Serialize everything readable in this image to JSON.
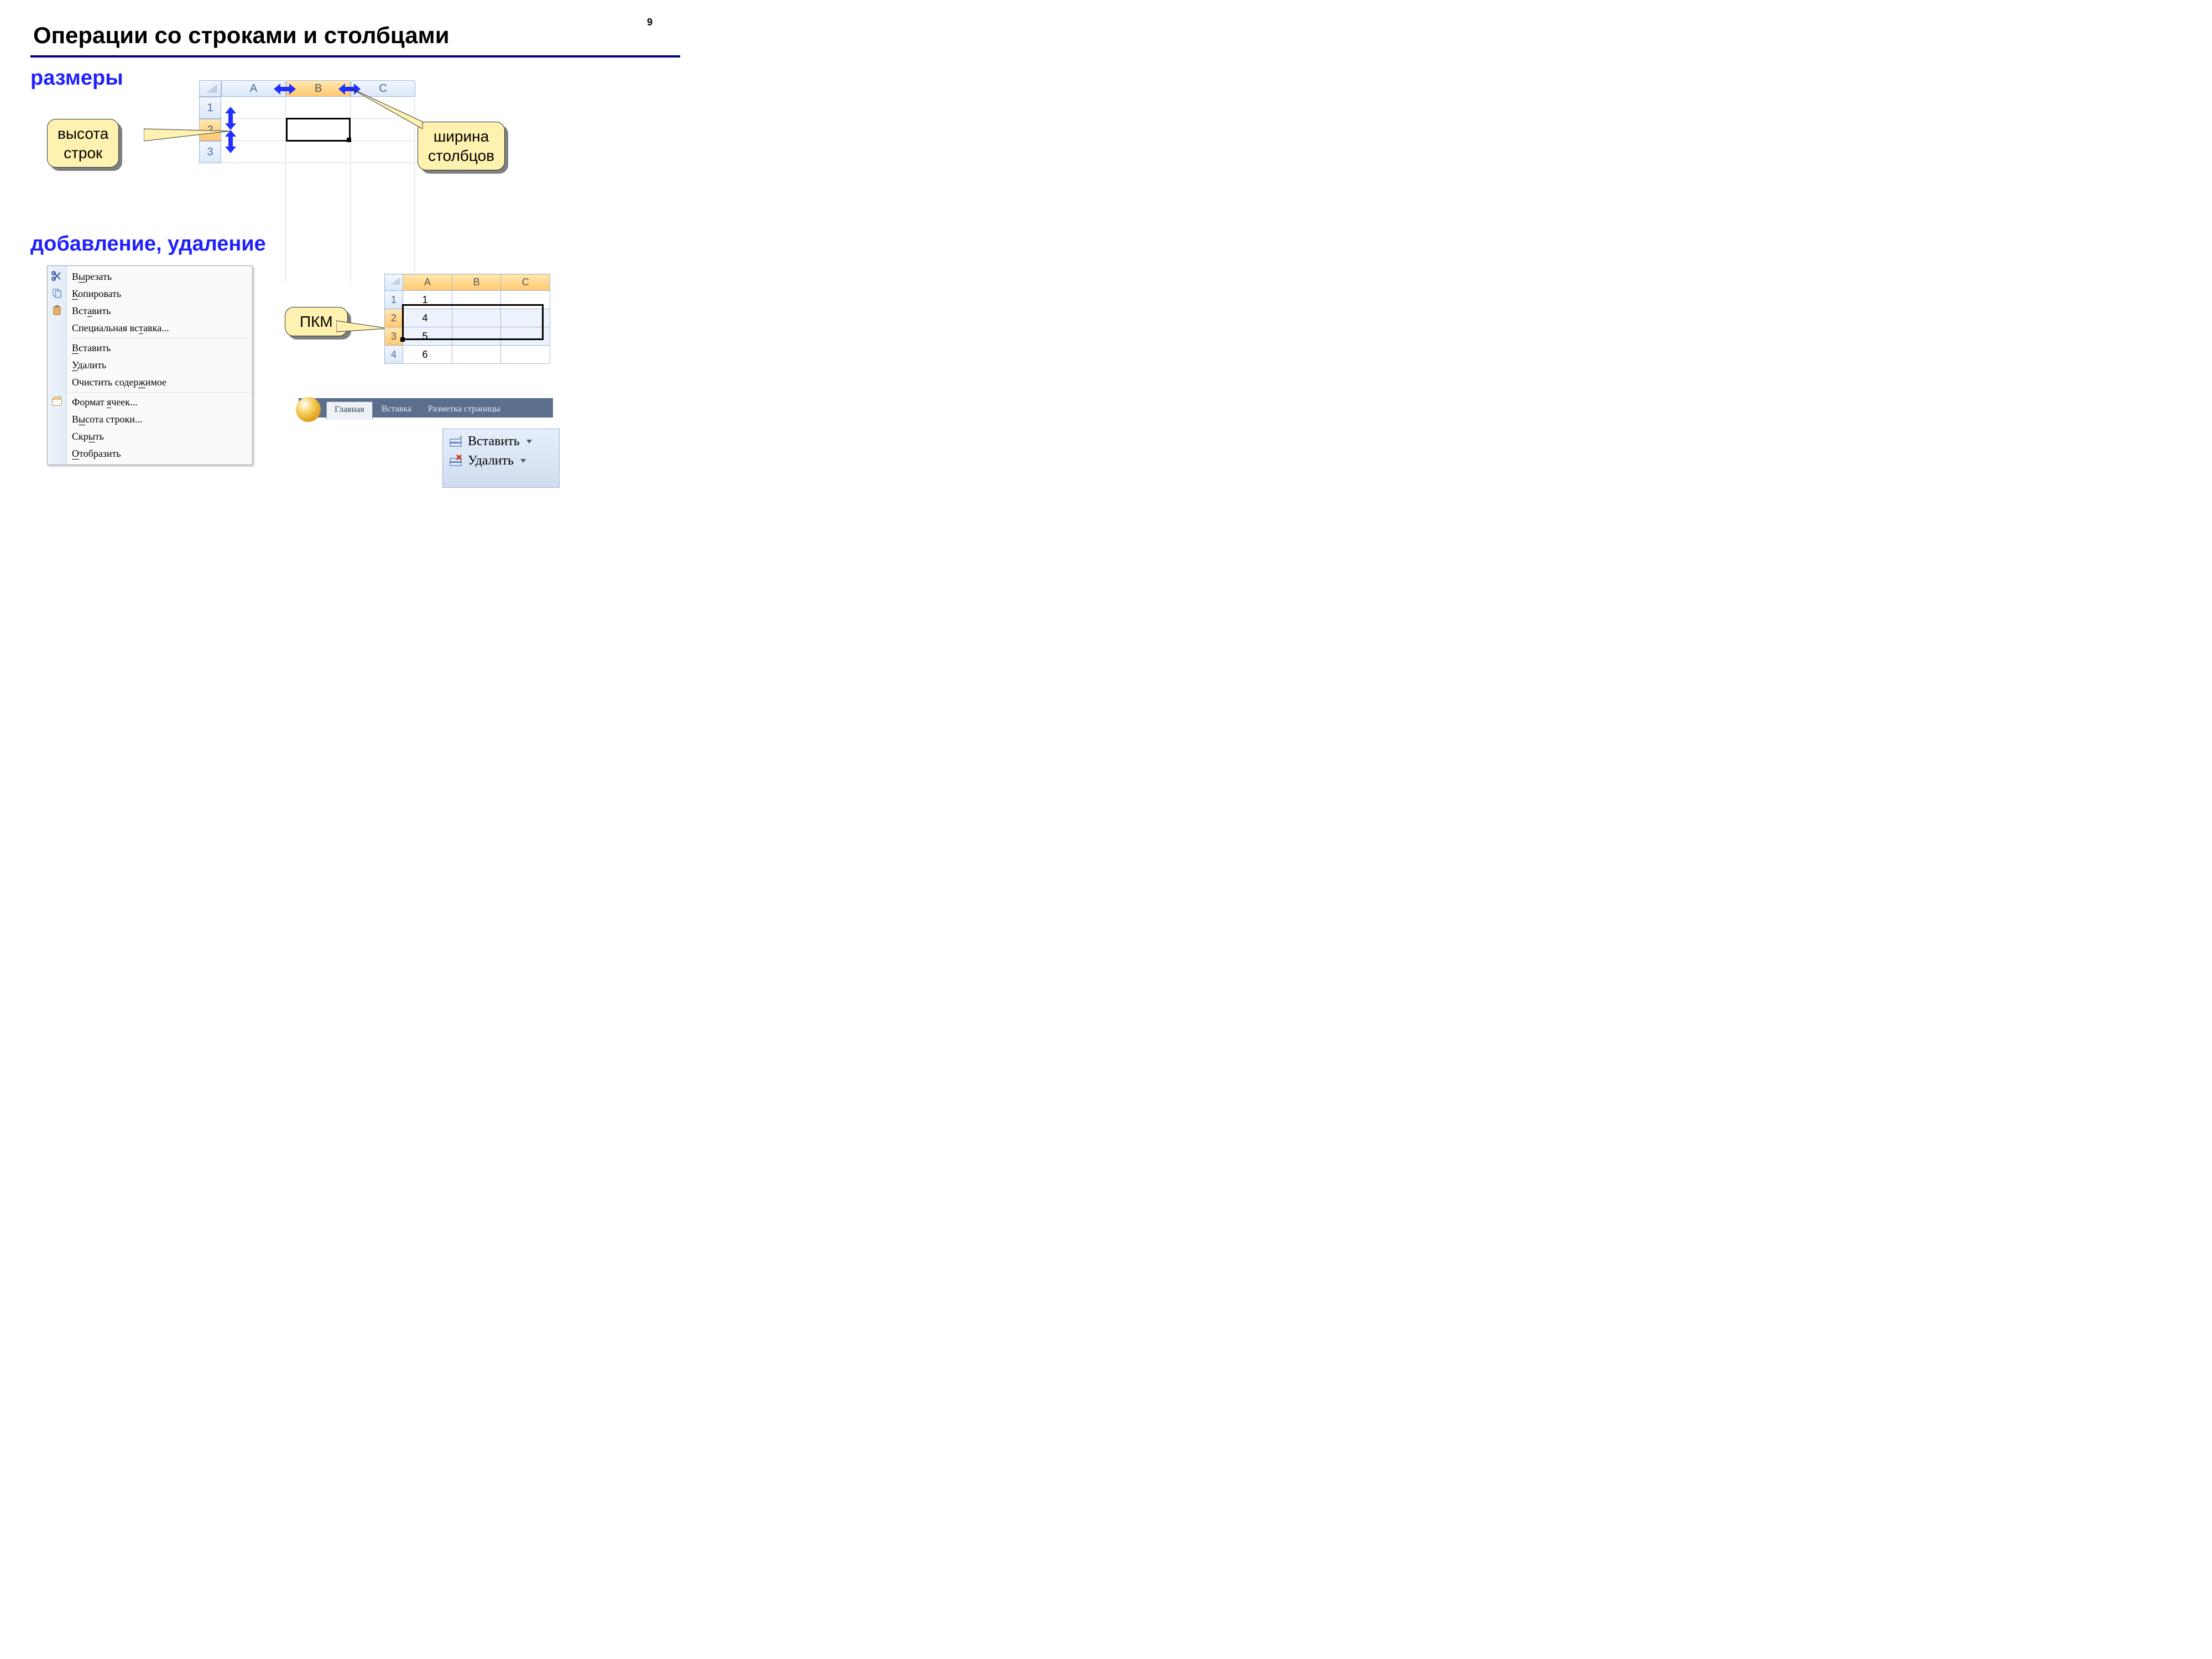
{
  "page_number": "9",
  "title": "Операции со строками и столбцами",
  "section1": "размеры",
  "section2": "добавление, удаление",
  "callout_rowheight_l1": "высота",
  "callout_rowheight_l2": "строк",
  "callout_colwidth_l1": "ширина",
  "callout_colwidth_l2": "столбцов",
  "callout_rmb": "ПКМ",
  "grid1_cols": {
    "A": "A",
    "B": "B",
    "C": "C"
  },
  "grid1_rows": {
    "r1": "1",
    "r2": "2",
    "r3": "3"
  },
  "context_menu": {
    "cut": "Вырезать",
    "copy": "Копировать",
    "paste": "Вставить",
    "pastespec": "Специальная вставка...",
    "insert": "Вставить",
    "delete": "Удалить",
    "clear": "Очистить содержимое",
    "format": "Формат ячеек...",
    "rowheight": "Высота строки...",
    "hide": "Скрыть",
    "unhide": "Отобразить"
  },
  "grid2": {
    "cols": {
      "A": "A",
      "B": "B",
      "C": "C"
    },
    "rows": {
      "r1": "1",
      "r2": "2",
      "r3": "3",
      "r4": "4"
    },
    "vals": {
      "a1": "1",
      "a2": "4",
      "a3": "5",
      "a4": "6"
    }
  },
  "ribbon_tabs": {
    "home": "Главная",
    "insert": "Вставка",
    "layout": "Разметка страницы"
  },
  "ribbon_btn_insert": "Вставить",
  "ribbon_btn_delete": "Удалить"
}
